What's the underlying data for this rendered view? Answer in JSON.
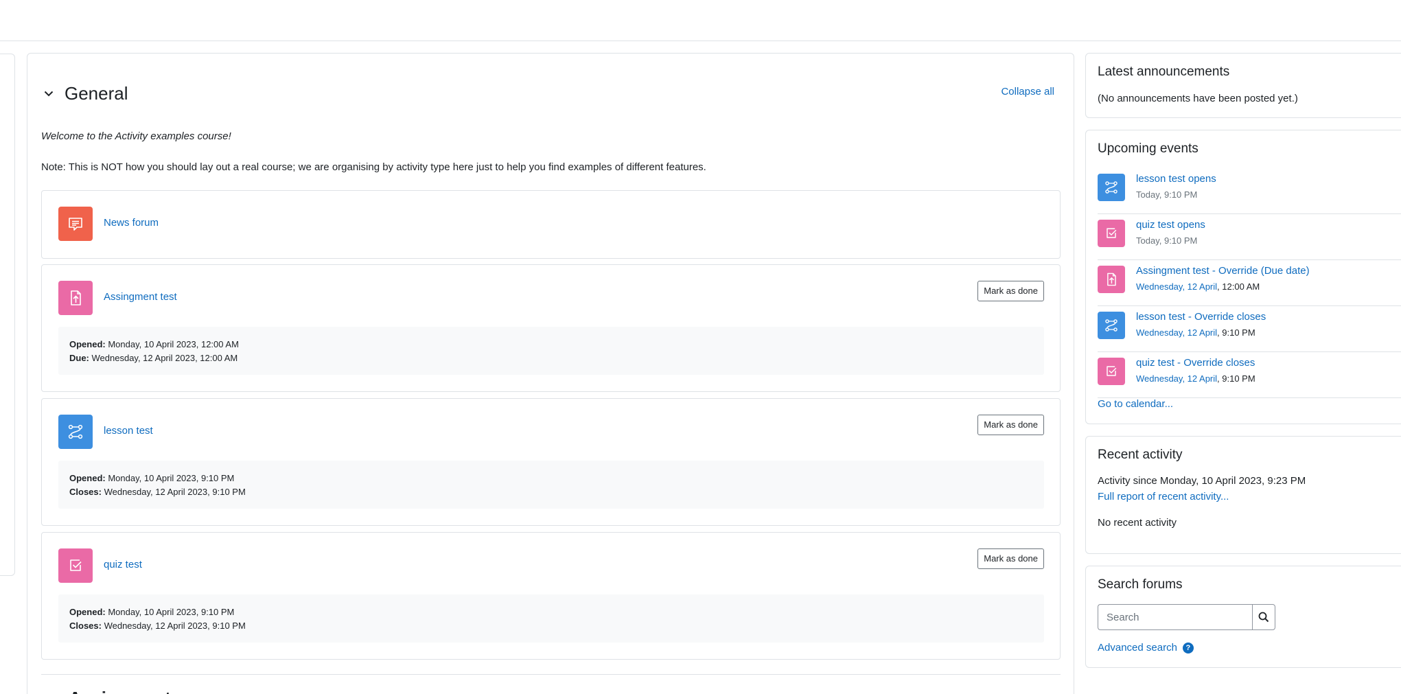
{
  "section": {
    "title": "General",
    "collapse_all": "Collapse all",
    "intro": "Welcome to the Activity examples course!",
    "note": "Note: This is NOT how you should lay out a real course; we are organising by activity type here just to help you find examples of different features.",
    "next_section_title": "Assignments"
  },
  "activities": {
    "forum": {
      "name": "News forum"
    },
    "assignment": {
      "name": "Assingment test",
      "mark_label": "Mark as done",
      "line1_label": "Opened:",
      "line1_value": " Monday, 10 April 2023, 12:00 AM",
      "line2_label": "Due:",
      "line2_value": " Wednesday, 12 April 2023, 12:00 AM"
    },
    "lesson": {
      "name": "lesson test",
      "mark_label": "Mark as done",
      "line1_label": "Opened:",
      "line1_value": " Monday, 10 April 2023, 9:10 PM",
      "line2_label": "Closes:",
      "line2_value": " Wednesday, 12 April 2023, 9:10 PM"
    },
    "quiz": {
      "name": "quiz test",
      "mark_label": "Mark as done",
      "line1_label": "Opened:",
      "line1_value": " Monday, 10 April 2023, 9:10 PM",
      "line2_label": "Closes:",
      "line2_value": " Wednesday, 12 April 2023, 9:10 PM"
    }
  },
  "blocks": {
    "announcements": {
      "title": "Latest announcements",
      "text": "(No announcements have been posted yet.)"
    },
    "upcoming": {
      "title": "Upcoming events",
      "events": [
        {
          "name": "lesson test opens",
          "date": "Today",
          "time": ", 9:10 PM",
          "icon": "lesson-icon"
        },
        {
          "name": "quiz test opens",
          "date": "Today",
          "time": ", 9:10 PM",
          "icon": "quiz-icon"
        },
        {
          "name": "Assingment test - Override (Due date)",
          "date": "Wednesday, 12 April",
          "time": ", 12:00 AM",
          "icon": "assignment-icon"
        },
        {
          "name": "lesson test - Override closes",
          "date": "Wednesday, 12 April",
          "time": ", 9:10 PM",
          "icon": "lesson-icon"
        },
        {
          "name": "quiz test - Override closes",
          "date": "Wednesday, 12 April",
          "time": ", 9:10 PM",
          "icon": "quiz-icon"
        }
      ],
      "calendar_link": "Go to calendar..."
    },
    "recent": {
      "title": "Recent activity",
      "since": "Activity since Monday, 10 April 2023, 9:23 PM",
      "full_report": "Full report of recent activity...",
      "none": "No recent activity"
    },
    "search": {
      "title": "Search forums",
      "placeholder": "Search",
      "advanced": "Advanced search",
      "help": "?"
    }
  },
  "colors": {
    "link": "#0f6cbf",
    "forum": "#f0624b",
    "assignment": "#ea6aa6",
    "lesson": "#3d8fe0",
    "quiz": "#ea6aa6"
  }
}
